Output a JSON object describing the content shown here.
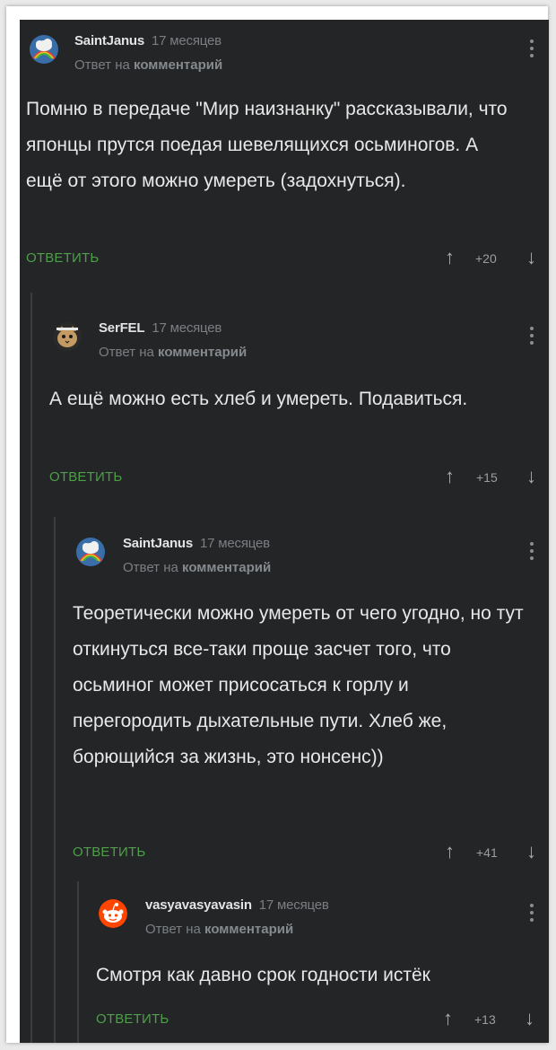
{
  "comments": [
    {
      "author": "SaintJanus",
      "time": "17 месяцев",
      "subline_prefix": "Ответ на",
      "subline_link": "комментарий",
      "text": "Помню в передаче \"Мир наизнанку\" рассказывали, что японцы прутся поедая шевелящихся осьминогов. А ещё от этого можно умереть (задохнуться).",
      "reply_label": "ОТВЕТИТЬ",
      "rating": "+20",
      "avatar_icon": "cloud-rainbow-avatar"
    },
    {
      "author": "SerFEL",
      "time": "17 месяцев",
      "subline_prefix": "Ответ на",
      "subline_link": "комментарий",
      "text": "А ещё можно есть хлеб и умереть. Подавиться.",
      "reply_label": "ОТВЕТИТЬ",
      "rating": "+15",
      "avatar_icon": "cat-avatar"
    },
    {
      "author": "SaintJanus",
      "time": "17 месяцев",
      "subline_prefix": "Ответ на",
      "subline_link": "комментарий",
      "text": "Теоретически можно умереть от чего угодно, но тут откинуться все-таки проще засчет того, что осьминог может присосаться к горлу и перегородить дыхательные пути. Хлеб же, борющийся за жизнь, это нонсенс))",
      "reply_label": "ОТВЕТИТЬ",
      "rating": "+41",
      "avatar_icon": "cloud-rainbow-avatar"
    },
    {
      "author": "vasyavasyavasin",
      "time": "17 месяцев",
      "subline_prefix": "Ответ на",
      "subline_link": "комментарий",
      "text": "Смотря как давно срок годности истёк",
      "reply_label": "ОТВЕТИТЬ",
      "rating": "+13",
      "avatar_icon": "reddit-alien-avatar"
    }
  ],
  "icons": {
    "upvote": "↑",
    "downvote": "↓"
  },
  "colors": {
    "background": "#232527",
    "reply": "#4f9f4a",
    "text": "#e8e8e8"
  }
}
